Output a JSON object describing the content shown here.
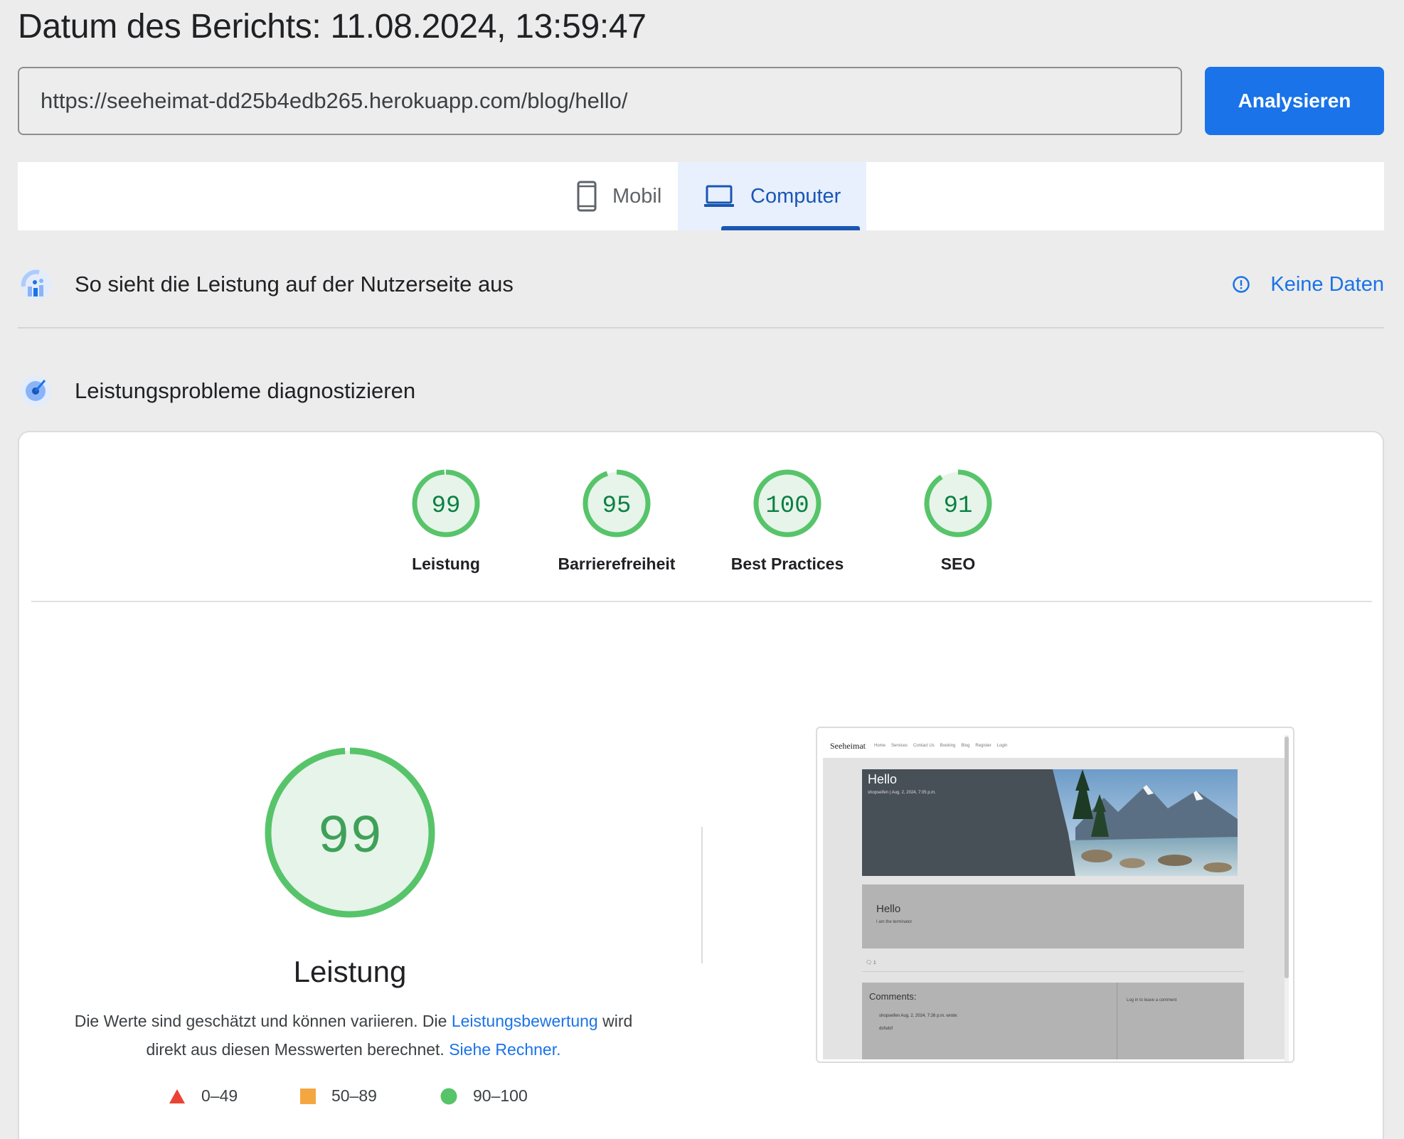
{
  "report": {
    "date_title": "Datum des Berichts: 11.08.2024, 13:59:47"
  },
  "search": {
    "url_value": "https://seeheimat-dd25b4edb265.herokuapp.com/blog/hello/",
    "analyze_label": "Analysieren"
  },
  "tabs": [
    {
      "label": "Mobil",
      "icon": "smartphone-icon",
      "active": false
    },
    {
      "label": "Computer",
      "icon": "laptop-icon",
      "active": true
    }
  ],
  "field_data": {
    "title": "So sieht die Leistung auf der Nutzerseite aus",
    "icon": "users-chart-icon",
    "status_label": "Keine Daten",
    "status_icon": "info-icon"
  },
  "diagnostics": {
    "title": "Leistungsprobleme diagnostizieren",
    "icon": "target-icon"
  },
  "scores": [
    {
      "label": "Leistung",
      "value": 99
    },
    {
      "label": "Barrierefreiheit",
      "value": 95
    },
    {
      "label": "Best Practices",
      "value": 100
    },
    {
      "label": "SEO",
      "value": 91
    }
  ],
  "performance": {
    "score": 99,
    "title": "Leistung",
    "desc_part1": "Die Werte sind geschätzt und können variieren. Die ",
    "desc_link1": "Leistungsbewertung",
    "desc_part2": " wird direkt aus diesen Messwerten berechnet. ",
    "desc_link2": "Siehe Rechner."
  },
  "legend": [
    {
      "range": "0–49",
      "icon": "red-triangle-icon",
      "color": "#ea4335"
    },
    {
      "range": "50–89",
      "icon": "orange-square-icon",
      "color": "#f4a741"
    },
    {
      "range": "90–100",
      "icon": "green-circle-icon",
      "color": "#57c46a"
    }
  ],
  "screenshot": {
    "logo": "Seeheimat",
    "nav": [
      "Home",
      "Services",
      "Contact Us",
      "Booking",
      "Blog",
      "Register",
      "Login"
    ],
    "hero_title": "Hello",
    "hero_meta": "shopseifen | Aug. 2, 2024, 7:05 p.m.",
    "post_title": "Hello",
    "post_text": "I am the terminator",
    "comment_count": "1",
    "comments_title": "Comments:",
    "comment_meta": "shopseifen Aug. 2, 2024, 7:26 p.m. wrote:",
    "comment_text": "dsfsdsf",
    "login_text": "Log in to leave a comment"
  },
  "colors": {
    "accent": "#1a73e8",
    "pass_green": "#57c46a",
    "pass_fill": "#e6f4ea",
    "pass_text": "#0b8043"
  }
}
